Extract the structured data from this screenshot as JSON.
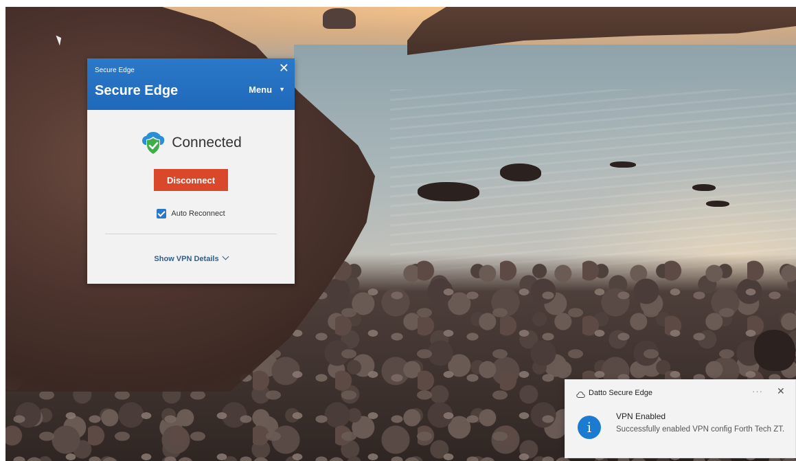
{
  "vpn_window": {
    "small_title": "Secure Edge",
    "close_glyph": "✕",
    "title": "Secure Edge",
    "menu_label": "Menu",
    "menu_caret": "▼",
    "status": "Connected",
    "status_icon": "shield-check-icon",
    "disconnect_label": "Disconnect",
    "auto_reconnect_label": "Auto Reconnect",
    "auto_reconnect_checked": true,
    "details_label": "Show VPN Details",
    "colors": {
      "header": "#2b78c8",
      "disconnect": "#d9482b",
      "details_link": "#2f5d8c"
    }
  },
  "toast": {
    "app_name": "Datto Secure Edge",
    "app_icon": "cloud-icon",
    "more_glyph": "···",
    "close_glyph": "✕",
    "info_glyph": "i",
    "title": "VPN Enabled",
    "body": "Successfully enabled VPN config Forth Tech ZT.",
    "colors": {
      "info_icon": "#1b7bd1"
    }
  }
}
